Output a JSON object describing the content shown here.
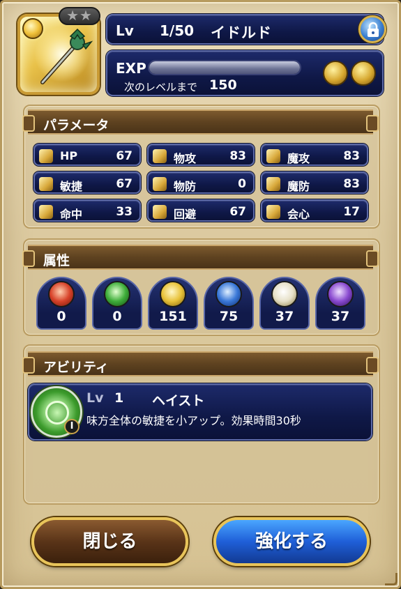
{
  "header": {
    "stars": "★★",
    "level_label": "Lv",
    "level_value": "1/50",
    "weapon_name": "イドルド",
    "exp_label": "EXP",
    "exp_progress": 0,
    "next_level_label": "次のレベルまで",
    "next_level_value": "150",
    "icons": [
      "weapon-icon",
      "light-element-icon",
      "lock-icon",
      "upgrade-icon",
      "feather-icon"
    ]
  },
  "parameters": {
    "title": "パラメータ",
    "stats": [
      {
        "name": "HP",
        "value": "67",
        "icon": "heart-icon"
      },
      {
        "name": "物攻",
        "value": "83",
        "icon": "sword-icon"
      },
      {
        "name": "魔攻",
        "value": "83",
        "icon": "staff-icon"
      },
      {
        "name": "敏捷",
        "value": "67",
        "icon": "wing-boot-icon"
      },
      {
        "name": "物防",
        "value": "0",
        "icon": "shield-icon"
      },
      {
        "name": "魔防",
        "value": "83",
        "icon": "magic-shield-icon"
      },
      {
        "name": "命中",
        "value": "33",
        "icon": "bow-icon"
      },
      {
        "name": "回避",
        "value": "67",
        "icon": "dodge-icon"
      },
      {
        "name": "会心",
        "value": "17",
        "icon": "fist-icon"
      }
    ]
  },
  "attributes": {
    "title": "属性",
    "elements": [
      {
        "value": "0",
        "icon": "fire-element-icon",
        "color": "#d8432a"
      },
      {
        "value": "0",
        "icon": "wind-element-icon",
        "color": "#3fae3a"
      },
      {
        "value": "151",
        "icon": "light-element-icon",
        "color": "#e8c23a"
      },
      {
        "value": "75",
        "icon": "water-element-icon",
        "color": "#3a78d8"
      },
      {
        "value": "37",
        "icon": "earth-element-icon",
        "color": "#e6e0c8"
      },
      {
        "value": "37",
        "icon": "dark-element-icon",
        "color": "#8a4ad0"
      }
    ]
  },
  "ability": {
    "title": "アビリティ",
    "level_label": "Lv",
    "level_value": "1",
    "name": "ヘイスト",
    "description": "味方全体の敏捷を小アップ。効果時間30秒",
    "badge": "I"
  },
  "buttons": {
    "close": "閉じる",
    "enhance": "強化する"
  },
  "colors": {
    "navy_panel": "#0f1847",
    "gold_accent": "#e8c45a",
    "enhance_blue": "#1f5fd8",
    "close_brown": "#5a3418"
  }
}
